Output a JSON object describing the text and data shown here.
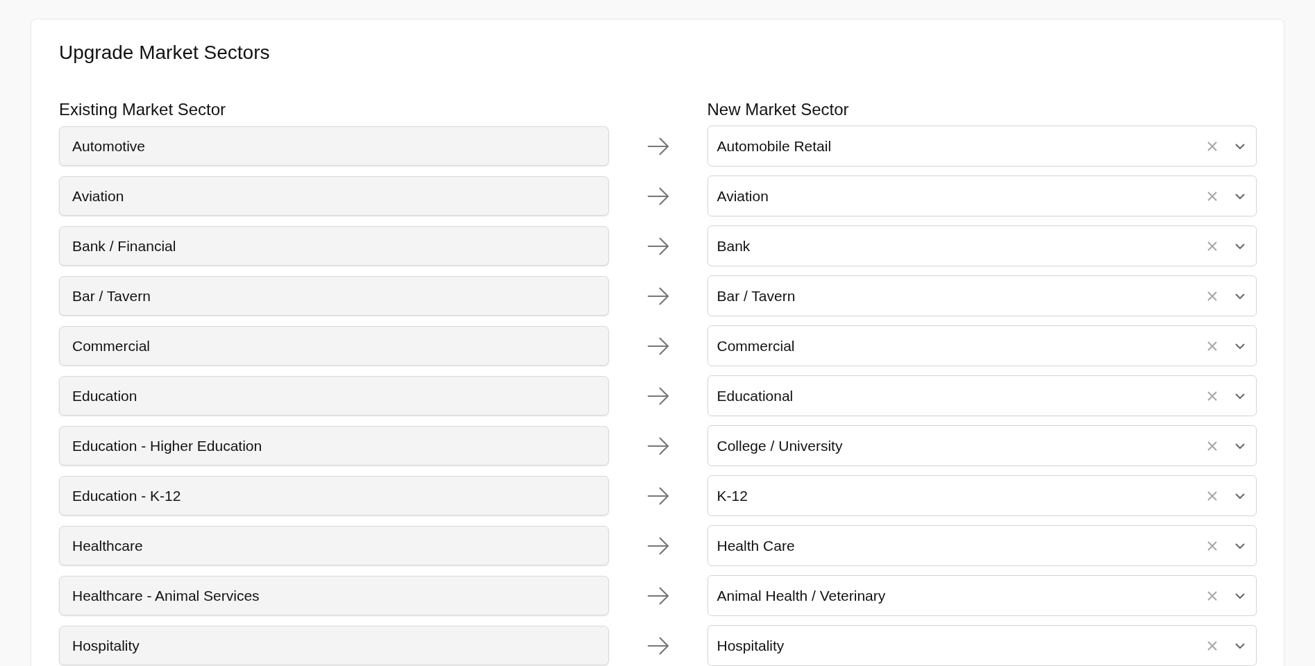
{
  "title": "Upgrade Market Sectors",
  "headings": {
    "existing": "Existing Market Sector",
    "new": "New Market Sector"
  },
  "rows": [
    {
      "existing": "Automotive",
      "new": "Automobile Retail"
    },
    {
      "existing": "Aviation",
      "new": "Aviation"
    },
    {
      "existing": "Bank / Financial",
      "new": "Bank"
    },
    {
      "existing": "Bar / Tavern",
      "new": "Bar / Tavern"
    },
    {
      "existing": "Commercial",
      "new": "Commercial"
    },
    {
      "existing": "Education",
      "new": "Educational"
    },
    {
      "existing": "Education - Higher Education",
      "new": "College / University"
    },
    {
      "existing": "Education - K-12",
      "new": "K-12"
    },
    {
      "existing": "Healthcare",
      "new": "Health Care"
    },
    {
      "existing": "Healthcare - Animal Services",
      "new": "Animal Health / Veterinary"
    },
    {
      "existing": "Hospitality",
      "new": "Hospitality"
    }
  ]
}
